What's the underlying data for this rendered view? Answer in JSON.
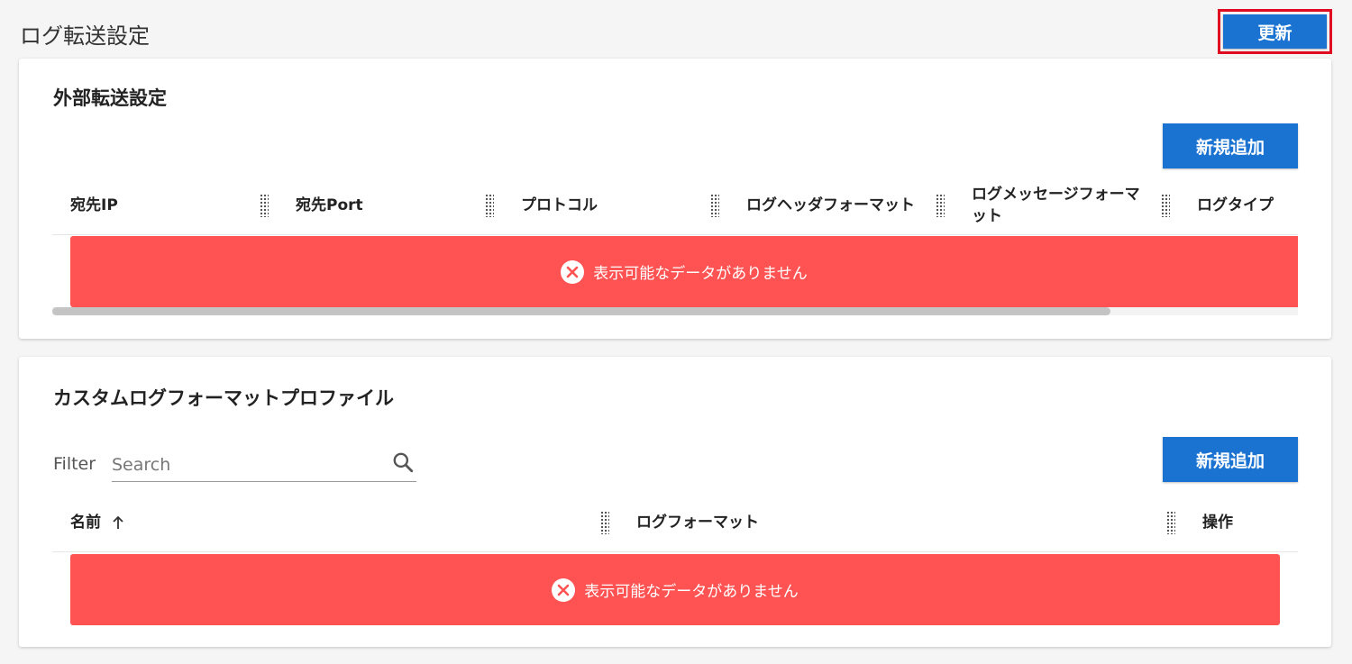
{
  "header": {
    "title": "ログ転送設定",
    "refresh_label": "更新"
  },
  "forwarding": {
    "title": "外部転送設定",
    "add_label": "新規追加",
    "columns": [
      "宛先IP",
      "宛先Port",
      "プロトコル",
      "ログヘッダフォーマット",
      "ログメッセージフォーマット",
      "ログタイプ"
    ],
    "empty_message": "表示可能なデータがありません"
  },
  "profiles": {
    "title": "カスタムログフォーマットプロファイル",
    "filter_label": "Filter",
    "search_placeholder": "Search",
    "search_value": "",
    "add_label": "新規追加",
    "columns": [
      "名前",
      "ログフォーマット",
      "操作"
    ],
    "empty_message": "表示可能なデータがありません"
  },
  "colors": {
    "primary": "#1a73d1",
    "error": "#ff5353",
    "highlight": "#e00b20"
  }
}
